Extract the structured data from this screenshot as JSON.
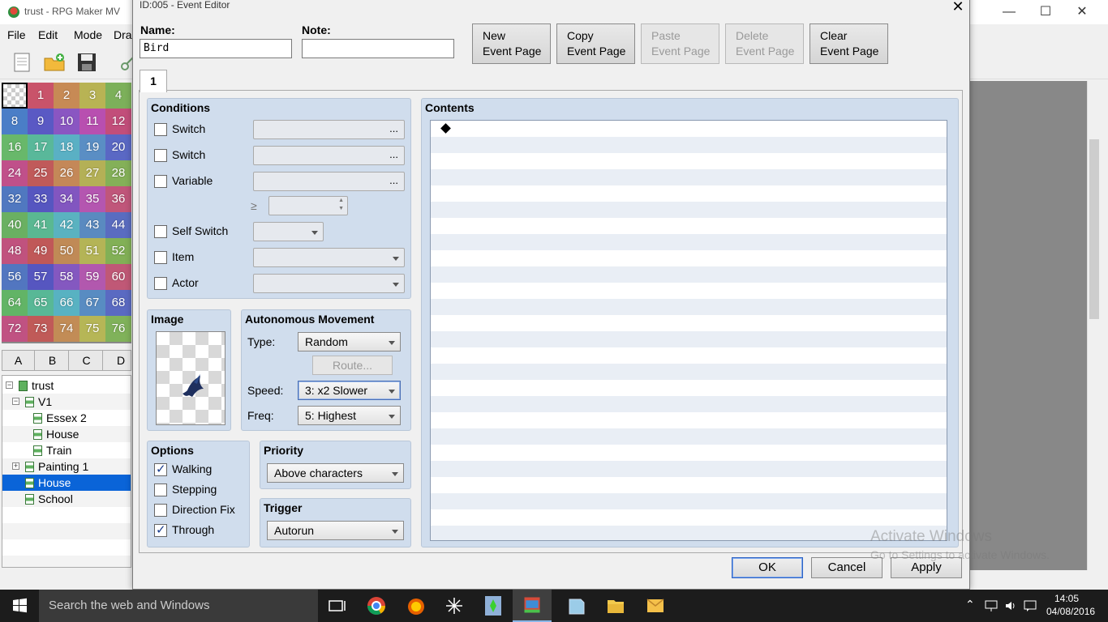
{
  "main": {
    "title": "trust - RPG Maker MV",
    "menu": [
      "File",
      "Edit",
      "Mode",
      "Dra"
    ],
    "palette_numbers": [
      "",
      "1",
      "2",
      "3",
      "4",
      "8",
      "9",
      "10",
      "11",
      "12",
      "16",
      "17",
      "18",
      "19",
      "20",
      "24",
      "25",
      "26",
      "27",
      "28",
      "32",
      "33",
      "34",
      "35",
      "36",
      "40",
      "41",
      "42",
      "43",
      "44",
      "48",
      "49",
      "50",
      "51",
      "52",
      "56",
      "57",
      "58",
      "59",
      "60",
      "64",
      "65",
      "66",
      "67",
      "68",
      "72",
      "73",
      "74",
      "75",
      "76"
    ],
    "tileset_tabs": [
      "A",
      "B",
      "C",
      "D"
    ],
    "tree": [
      {
        "label": "trust",
        "level": 0,
        "toggle": "−",
        "kind": "project"
      },
      {
        "label": "V1",
        "level": 1,
        "toggle": "−",
        "kind": "map"
      },
      {
        "label": "Essex 2",
        "level": 2,
        "toggle": "",
        "kind": "map"
      },
      {
        "label": "House",
        "level": 2,
        "toggle": "",
        "kind": "map"
      },
      {
        "label": "Train",
        "level": 2,
        "toggle": "",
        "kind": "map"
      },
      {
        "label": "Painting 1",
        "level": 1,
        "toggle": "+",
        "kind": "map"
      },
      {
        "label": "House",
        "level": 1,
        "toggle": "",
        "kind": "map",
        "selected": true
      },
      {
        "label": "School",
        "level": 1,
        "toggle": "",
        "kind": "map"
      }
    ],
    "watermark": {
      "line1": "Activate Windows",
      "line2": "Go to Settings to activate Windows."
    }
  },
  "dialog": {
    "title": "ID:005 - Event Editor",
    "name_label": "Name:",
    "name_value": "Bird",
    "note_label": "Note:",
    "note_value": "",
    "page_buttons": [
      {
        "line1": "New",
        "line2": "Event Page",
        "enabled": true
      },
      {
        "line1": "Copy",
        "line2": "Event Page",
        "enabled": true
      },
      {
        "line1": "Paste",
        "line2": "Event Page",
        "enabled": false
      },
      {
        "line1": "Delete",
        "line2": "Event Page",
        "enabled": false
      },
      {
        "line1": "Clear",
        "line2": "Event Page",
        "enabled": true
      }
    ],
    "page_tab": "1",
    "conditions": {
      "title": "Conditions",
      "rows": [
        {
          "label": "Switch",
          "checked": false
        },
        {
          "label": "Switch",
          "checked": false
        },
        {
          "label": "Variable",
          "checked": false
        },
        {
          "label": "Self Switch",
          "checked": false
        },
        {
          "label": "Item",
          "checked": false
        },
        {
          "label": "Actor",
          "checked": false
        }
      ],
      "ellipsis": "...",
      "gte_symbol": "≥"
    },
    "image": {
      "title": "Image"
    },
    "movement": {
      "title": "Autonomous Movement",
      "type_label": "Type:",
      "type_value": "Random",
      "route_label": "Route...",
      "speed_label": "Speed:",
      "speed_value": "3: x2 Slower",
      "freq_label": "Freq:",
      "freq_value": "5: Highest"
    },
    "options": {
      "title": "Options",
      "items": [
        {
          "label": "Walking",
          "checked": true
        },
        {
          "label": "Stepping",
          "checked": false
        },
        {
          "label": "Direction Fix",
          "checked": false
        },
        {
          "label": "Through",
          "checked": true
        }
      ]
    },
    "priority": {
      "title": "Priority",
      "value": "Above characters"
    },
    "trigger": {
      "title": "Trigger",
      "value": "Autorun"
    },
    "contents": {
      "title": "Contents"
    },
    "buttons": {
      "ok": "OK",
      "cancel": "Cancel",
      "apply": "Apply"
    }
  },
  "taskbar": {
    "search_placeholder": "Search the web and Windows",
    "time": "14:05",
    "date": "04/08/2016"
  }
}
